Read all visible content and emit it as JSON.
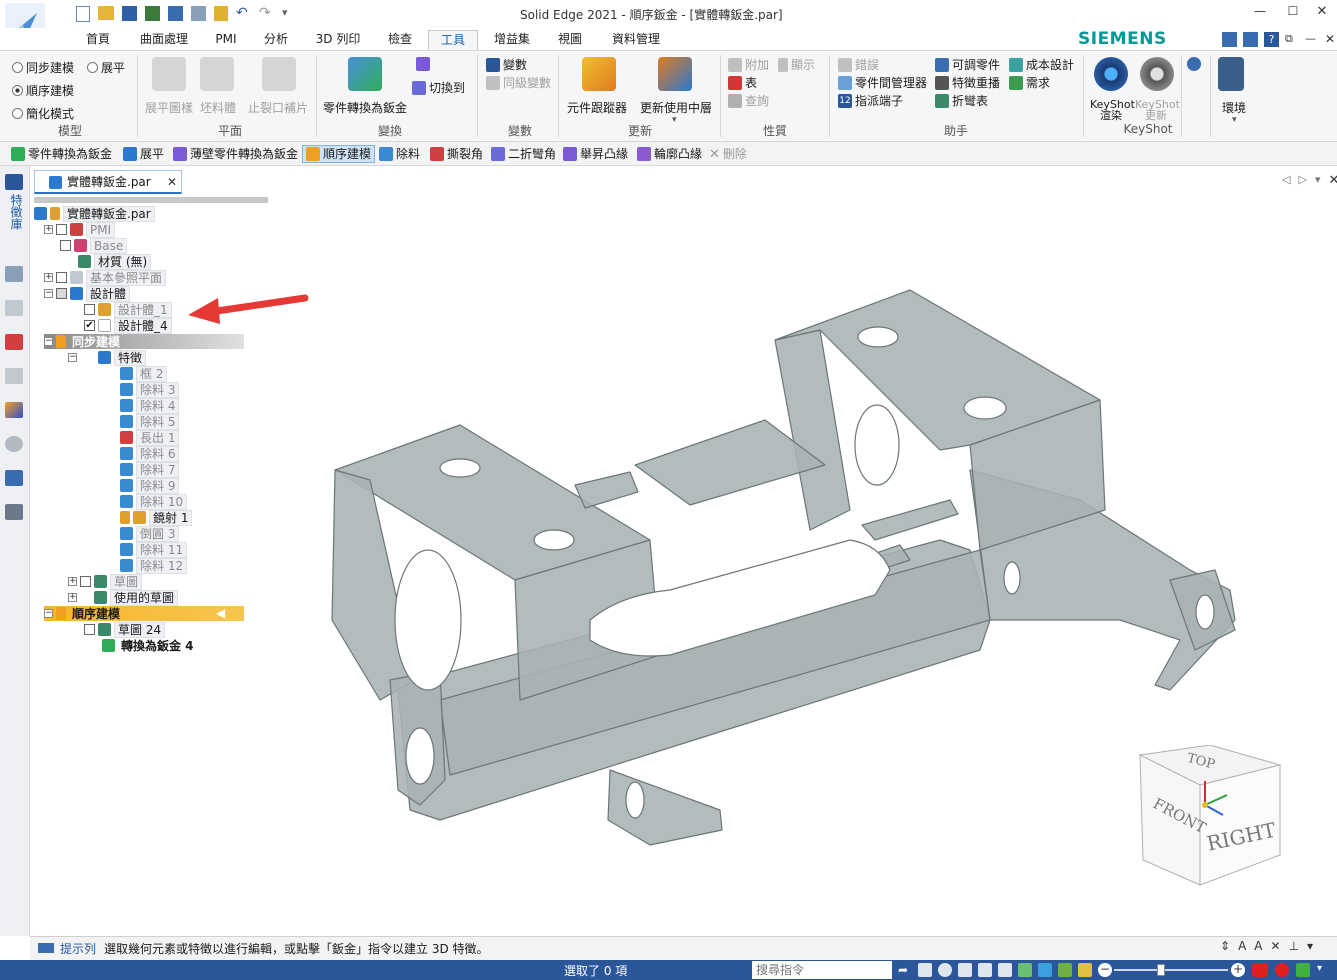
{
  "title_bar": {
    "title": "Solid Edge 2021 - 順序鈑金 - [實體轉鈑金.par]",
    "minimize_glyph": "—",
    "maximize_glyph": "☐",
    "close_glyph": "✕"
  },
  "ribbon_tabs": [
    "首頁",
    "曲面處理",
    "PMI",
    "分析",
    "3D 列印",
    "檢查",
    "工具",
    "增益集",
    "視圖",
    "資料管理"
  ],
  "active_tab": "工具",
  "brand": "SIEMENS",
  "ribbon": {
    "model_group": {
      "label": "模型",
      "options": [
        "同步建模",
        "順序建模",
        "簡化模式"
      ],
      "option_extra": "展平",
      "selected": "順序建模"
    },
    "flat_group": {
      "label": "平面",
      "items": [
        "展平圖樣",
        "坯料體",
        "止裂口補片"
      ]
    },
    "transform_group": {
      "label": "變換",
      "items": [
        "零件轉換為鈑金",
        "切換到"
      ]
    },
    "variables_group": {
      "label": "變數",
      "items": [
        "變數",
        "同級變數"
      ]
    },
    "update_group": {
      "label": "更新",
      "items": [
        "元件跟蹤器",
        "更新使用中層"
      ]
    },
    "properties_group": {
      "label": "性質",
      "items": [
        "附加",
        "顯示",
        "表",
        "查詢"
      ]
    },
    "assistant_group": {
      "label": "助手",
      "items": [
        "錯誤",
        "零件間管理器",
        "指派端子",
        "可調零件",
        "特徵重播",
        "折彎表",
        "成本設計",
        "需求"
      ]
    },
    "keyshot_group": {
      "label": "KeyShot",
      "items": [
        "KeyShot 渲染",
        "KeyShot 更新"
      ]
    },
    "env_group": {
      "label": "",
      "items": [
        "環境"
      ]
    }
  },
  "command_bar": {
    "items": [
      "零件轉換為鈑金",
      "展平",
      "薄壁零件轉換為鈑金",
      "順序建模",
      "除料",
      "撕裂角",
      "二折彎角",
      "舉昇凸緣",
      "輪廓凸緣",
      "刪除"
    ],
    "active": "順序建模"
  },
  "doc_tab": {
    "label": "實體轉鈑金.par"
  },
  "left_rail_label": "特徵庫",
  "tree": {
    "root": "實體轉鈑金.par",
    "pmi": "PMI",
    "base": "Base",
    "material": "材質 (無)",
    "ref_planes": "基本參照平面",
    "design_body": "設計體",
    "design_body_1": "設計體_1",
    "design_body_4": "設計體_4",
    "sync_modeling": "同步建模",
    "features": "特徵",
    "feature_items": [
      "框 2",
      "除料 3",
      "除料 4",
      "除料 5",
      "長出 1",
      "除料 6",
      "除料 7",
      "除料 9",
      "除料 10",
      "鏡射 1",
      "倒圓 3",
      "除料 11",
      "除料 12"
    ],
    "sketch": "草圖",
    "used_sketch": "使用的草圖",
    "ordered_modeling": "順序建模",
    "sketch24": "草圖 24",
    "convert": "轉換為鈑金 4"
  },
  "view_cube": {
    "top": "TOP",
    "front": "FRONT",
    "right": "RIGHT"
  },
  "prompt": {
    "label": "提示列",
    "text": "選取幾何元素或特徵以進行編輯，或點擊「鈑金」指令以建立 3D 特徵。"
  },
  "status": {
    "selected_text": "選取了 0 項",
    "search_placeholder": "搜尋指令"
  },
  "colors": {
    "accent": "#2b579a",
    "brand": "#00a0a0",
    "part": "#a7b2b2",
    "part_edge": "#6d7878"
  }
}
